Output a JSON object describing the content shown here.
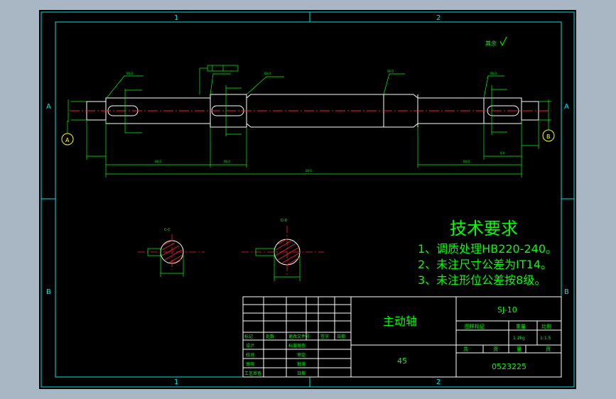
{
  "colors": {
    "background": "#a9b6c3",
    "paper": "#000000",
    "frame": "#00e5e5",
    "geometry": "#ffffff",
    "centerline": "#ff2020",
    "dimension": "#00ff00",
    "text": "#00ff00",
    "hatch": "#ff2020"
  },
  "zones": {
    "top": [
      "1",
      "2"
    ],
    "bottom": [
      "1",
      "2"
    ],
    "left": [
      "A",
      "B"
    ],
    "right": [
      "A",
      "B"
    ]
  },
  "tech_requirements": {
    "title": "技术要求",
    "items": [
      "1、调质处理HB220-240。",
      "2、未注尺寸公差为IT14。",
      "3、未注形位公差按8级。"
    ]
  },
  "roughness_note": "其余",
  "datums": {
    "left": "A",
    "right": "B"
  },
  "sections": {
    "first": "C-C",
    "second": "D-D"
  },
  "title_block": {
    "part_name": "主动轴",
    "drawing_no": "SJ-10",
    "material": "45",
    "student_no": "0523225",
    "mark_label": "图样标记",
    "weight_label": "重量",
    "scale_label": "比例",
    "weight": "1.2kg",
    "scale": "1:1.5",
    "sheet_total_label": "共",
    "sheet_page_label": "页",
    "sheet_label": "第",
    "sheet_page2_label": "页",
    "rev_headers": [
      "标记",
      "处数",
      "更改文件号",
      "签字",
      "日期"
    ],
    "roles": [
      "设计",
      "校对",
      "审核",
      "工艺审查"
    ],
    "roles2": [
      "标准审查",
      "审定",
      "批准",
      "日期"
    ]
  }
}
